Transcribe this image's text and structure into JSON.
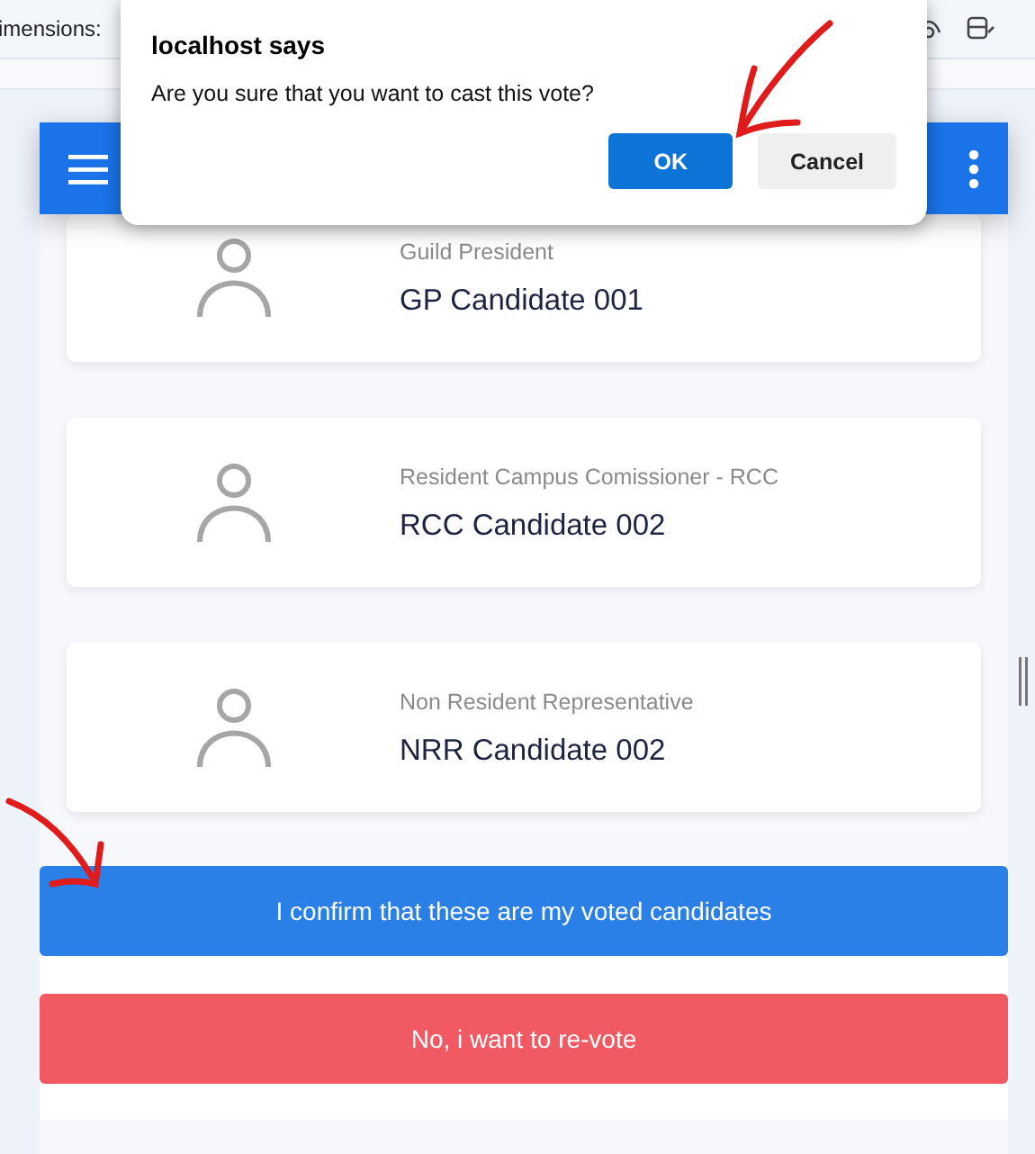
{
  "browser_bar": {
    "text": "imensions:"
  },
  "dialog": {
    "title": "localhost says",
    "message": "Are you sure that you want to cast this vote?",
    "buttons": [
      {
        "label": "OK",
        "kind": "primary"
      },
      {
        "label": "Cancel",
        "kind": "secondary"
      }
    ]
  },
  "candidates": [
    {
      "position": "Guild President",
      "name": "GP Candidate 001"
    },
    {
      "position": "Resident Campus Comissioner - RCC",
      "name": "RCC Candidate 002"
    },
    {
      "position": "Non Resident Representative",
      "name": "NRR Candidate 002"
    }
  ],
  "actions": [
    {
      "label": "I confirm that these are my voted candidates",
      "kind": "confirm"
    },
    {
      "label": "No, i want to re-vote",
      "kind": "cancel"
    }
  ]
}
